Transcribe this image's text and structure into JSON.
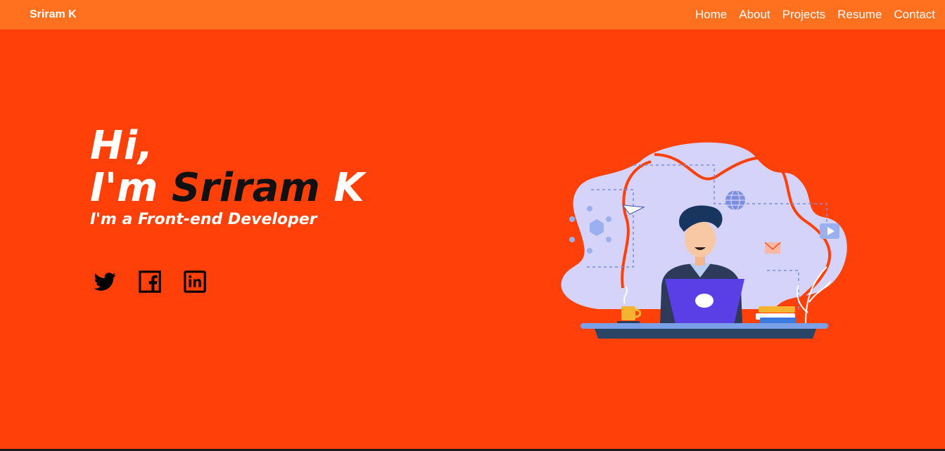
{
  "navbar": {
    "brand": "Sriram K",
    "links": [
      {
        "label": "Home"
      },
      {
        "label": "About"
      },
      {
        "label": "Projects"
      },
      {
        "label": "Resume"
      },
      {
        "label": "Contact"
      }
    ]
  },
  "hero": {
    "greeting": "Hi,",
    "intro_prefix": "I'm ",
    "name_main": "Sriram ",
    "name_last": "K",
    "role": "I'm a Front-end Developer"
  },
  "socials": [
    {
      "icon": "twitter-icon"
    },
    {
      "icon": "facebook-icon"
    },
    {
      "icon": "linkedin-icon"
    }
  ],
  "colors": {
    "background": "#ff4109",
    "navbar": "#ff701f",
    "text_light": "#ffffff",
    "text_dark": "#111111",
    "illustration_blob": "#d6d3fb",
    "laptop": "#5a3ee6"
  }
}
